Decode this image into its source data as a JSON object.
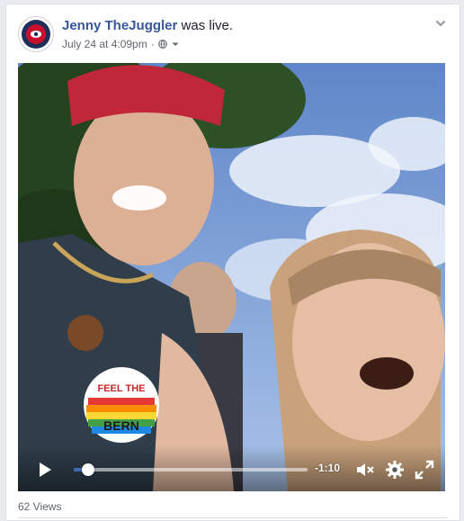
{
  "post": {
    "author": "Jenny TheJuggler",
    "action": " was live.",
    "timestamp": "July 24 at 4:09pm",
    "separator": "·",
    "audience_icon": "globe-icon"
  },
  "video": {
    "time_remaining": "-1:10",
    "progress": 0.06,
    "badge_text_top": "FEEL THE",
    "badge_text_bottom": "BERN"
  },
  "footer": {
    "views": "62 Views"
  },
  "colors": {
    "link": "#365899",
    "meta": "#616770",
    "progress": "#4267b2"
  }
}
